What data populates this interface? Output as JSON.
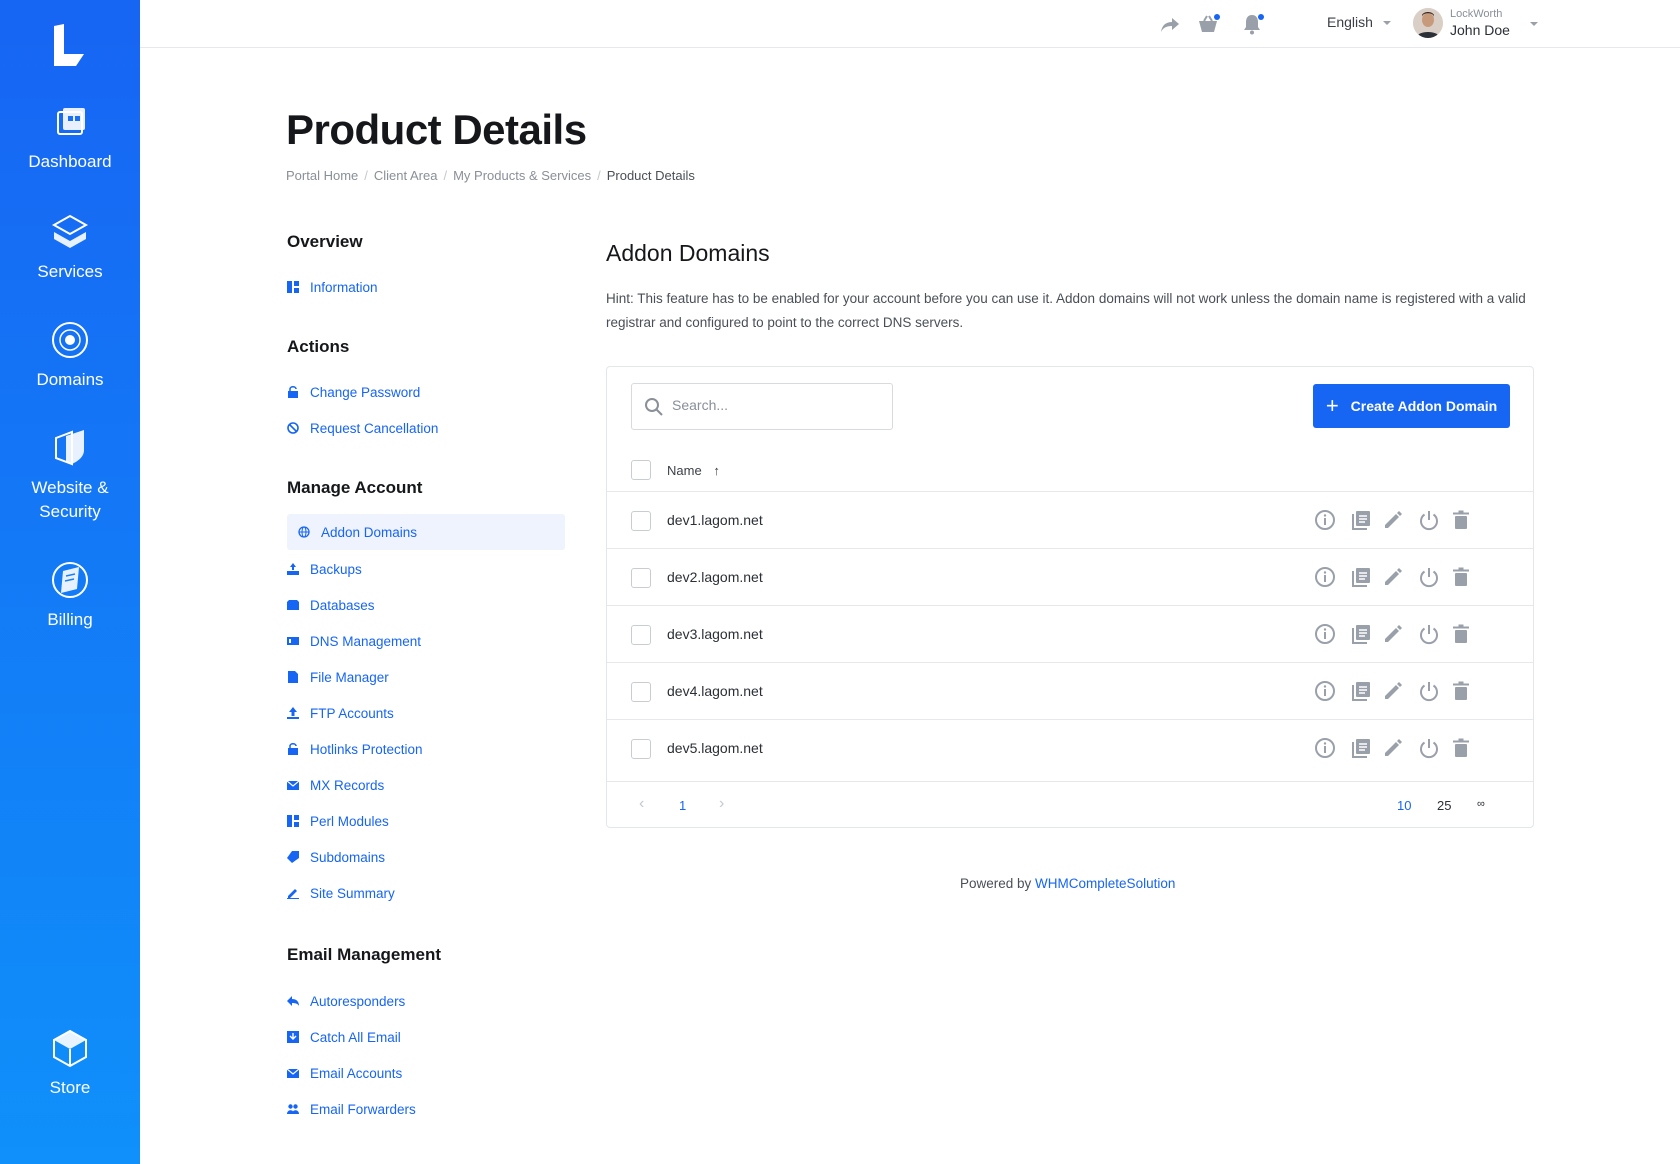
{
  "sidebar": {
    "items": [
      {
        "label": "Dashboard",
        "icon": "dashboard-icon"
      },
      {
        "label": "Services",
        "icon": "services-icon"
      },
      {
        "label": "Domains",
        "icon": "domains-icon"
      },
      {
        "label": "Website &",
        "label2": "Security",
        "icon": "website-security-icon"
      },
      {
        "label": "Billing",
        "icon": "billing-icon"
      },
      {
        "label": "Store",
        "icon": "store-icon"
      }
    ]
  },
  "topbar": {
    "language": "English",
    "company": "LockWorth",
    "user_name": "John Doe"
  },
  "page": {
    "title": "Product Details",
    "breadcrumb": [
      "Portal Home",
      "Client Area",
      "My Products & Services",
      "Product Details"
    ]
  },
  "left": {
    "overview_title": "Overview",
    "overview": [
      "Information"
    ],
    "actions_title": "Actions",
    "actions": [
      "Change Password",
      "Request Cancellation"
    ],
    "manage_title": "Manage Account",
    "manage": [
      "Addon Domains",
      "Backups",
      "Databases",
      "DNS Management",
      "File Manager",
      "FTP Accounts",
      "Hotlinks Protection",
      "MX Records",
      "Perl Modules",
      "Subdomains",
      "Site Summary"
    ],
    "email_title": "Email Management",
    "email": [
      "Autoresponders",
      "Catch All Email",
      "Email Accounts",
      "Email Forwarders"
    ]
  },
  "main": {
    "title": "Addon Domains",
    "hint": "Hint: This feature has to be enabled for your account before you can use it. Addon domains will not work unless the domain name is registered with a valid registrar and configured to point to the correct DNS servers.",
    "search_placeholder": "Search...",
    "create_label": "Create Addon Domain",
    "column_name": "Name",
    "sort_arrow": "↑",
    "rows": [
      "dev1.lagom.net",
      "dev2.lagom.net",
      "dev3.lagom.net",
      "dev4.lagom.net",
      "dev5.lagom.net"
    ],
    "pager": {
      "prev": "‹",
      "page": "1",
      "next": "›",
      "sizes": [
        "10",
        "25",
        "∞"
      ],
      "active_size": "10"
    }
  },
  "footer": {
    "prefix": "Powered by ",
    "link": "WHMCompleteSolution"
  },
  "colors": {
    "accent": "#1765f3",
    "sidebar_top": "#1765f3",
    "sidebar_bottom": "#0f90fa"
  }
}
